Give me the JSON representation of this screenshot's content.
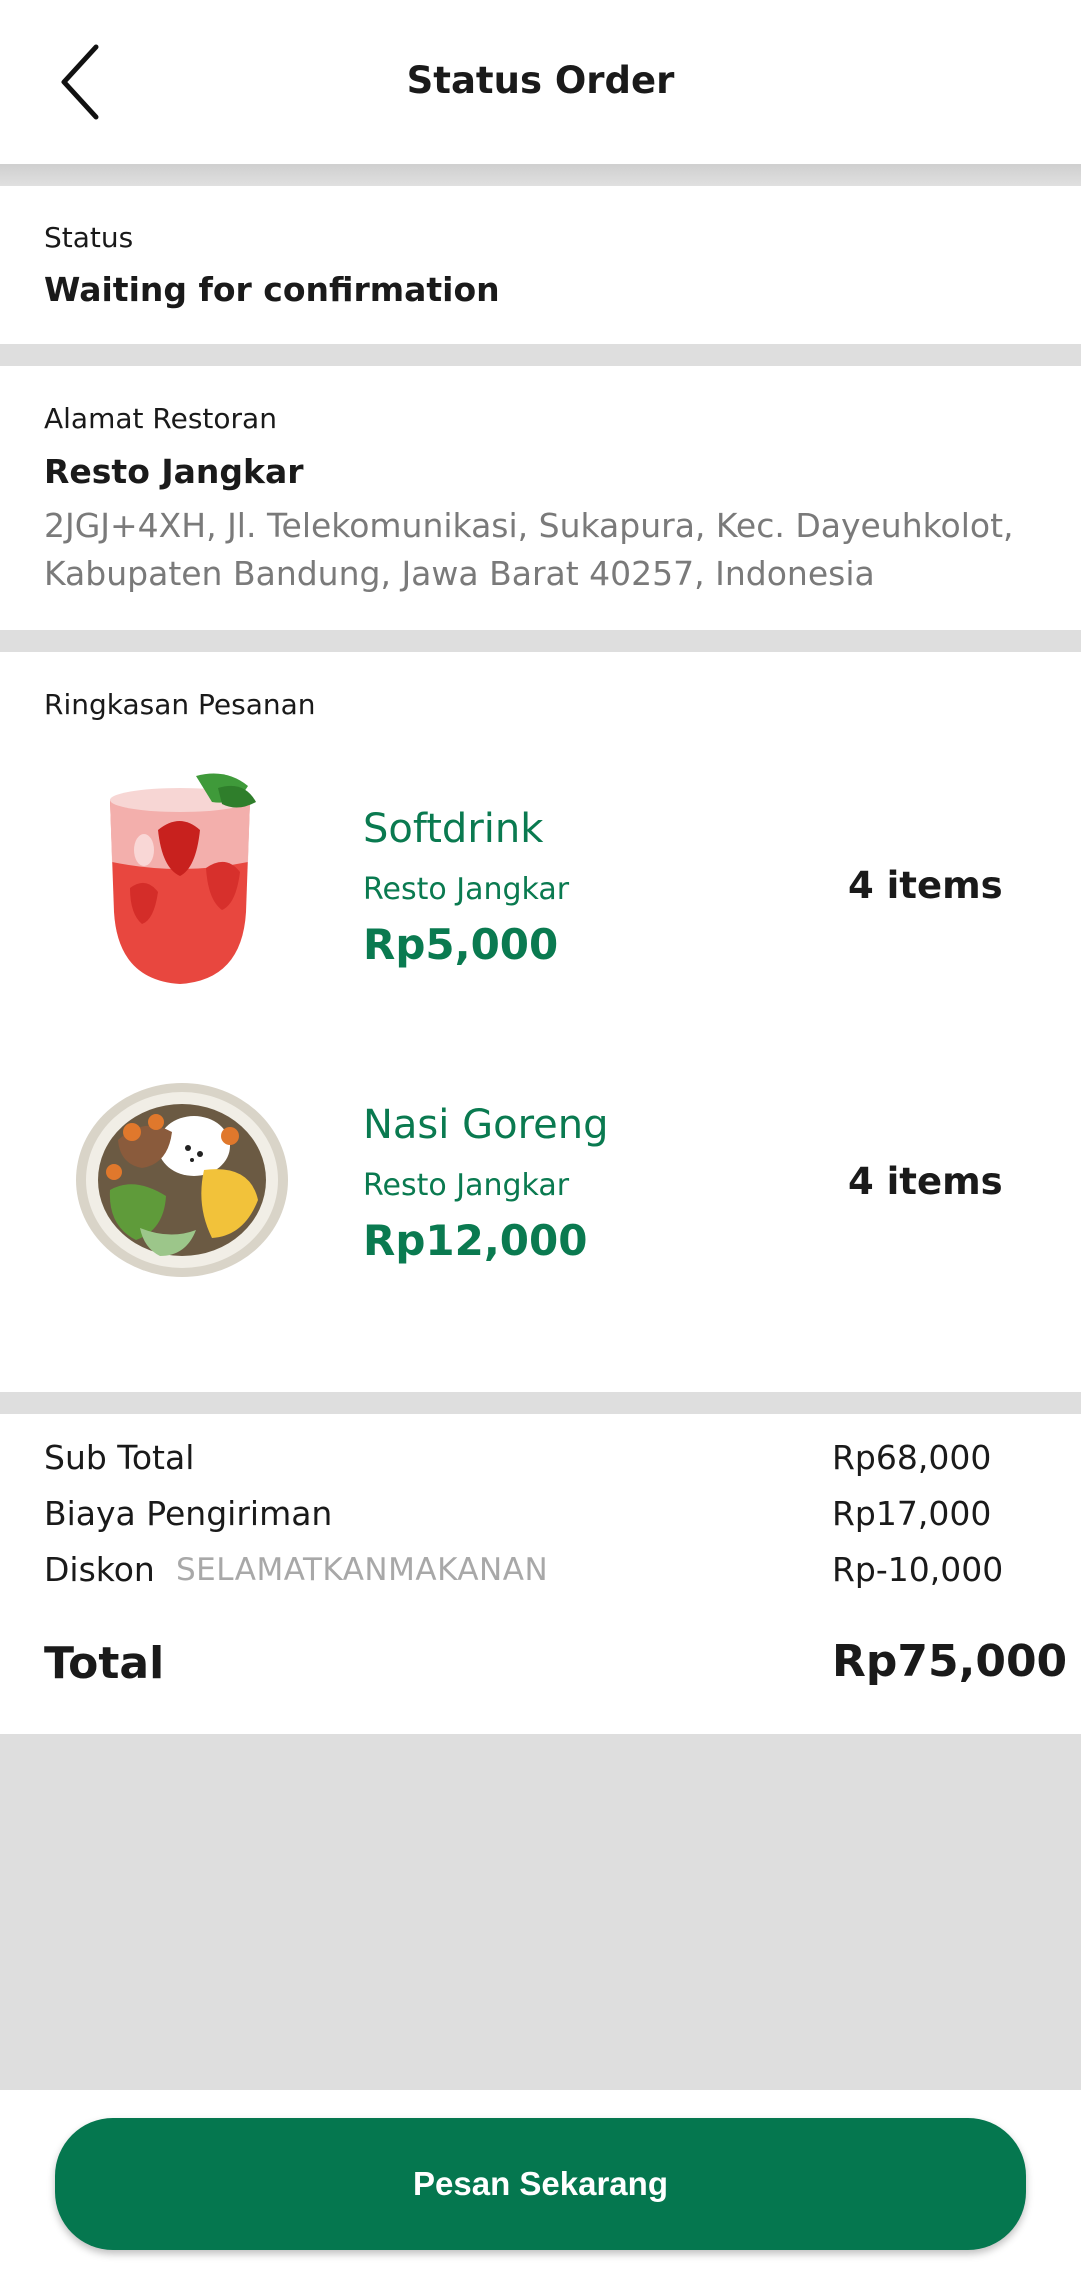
{
  "header": {
    "title": "Status Order"
  },
  "status": {
    "label": "Status",
    "value": "Waiting for confirmation"
  },
  "restaurant": {
    "label": "Alamat Restoran",
    "name": "Resto Jangkar",
    "address_line1": "2JGJ+4XH, Jl. Telekomunikasi, Sukapura, Kec. Dayeuhkolot,",
    "address_line2": "Kabupaten Bandung, Jawa Barat 40257, Indonesia"
  },
  "order": {
    "label": "Ringkasan Pesanan",
    "items": [
      {
        "name": "Softdrink",
        "resto": "Resto Jangkar",
        "price": "Rp5,000",
        "qty": "4 items",
        "image": "strawberry-drink"
      },
      {
        "name": "Nasi Goreng",
        "resto": "Resto Jangkar",
        "price": "Rp12,000",
        "qty": "4 items",
        "image": "rice-bowl"
      }
    ]
  },
  "summary": {
    "subtotal_label": "Sub Total",
    "subtotal_value": "Rp68,000",
    "delivery_label": "Biaya Pengiriman",
    "delivery_value": "Rp17,000",
    "discount_label": "Diskon",
    "discount_code": "SELAMATKANMAKANAN",
    "discount_value": "Rp-10,000",
    "total_label": "Total",
    "total_value": "Rp75,000"
  },
  "cta": {
    "label": "Pesan Sekarang"
  },
  "colors": {
    "brand_green": "#05774f",
    "item_text_green": "#0a7a50",
    "divider_gray": "#dedede"
  }
}
